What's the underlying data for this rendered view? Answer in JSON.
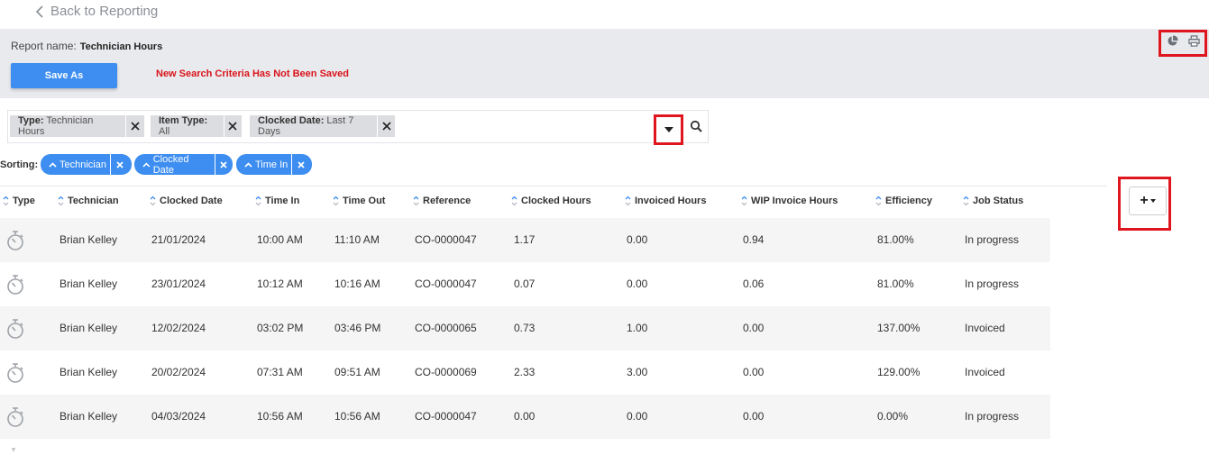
{
  "nav": {
    "back_label": "Back to Reporting"
  },
  "report": {
    "name_label": "Report name:",
    "name_value": "Technician Hours"
  },
  "actions": {
    "save_as_label": "Save As",
    "warning": "New Search Criteria Has Not Been Saved"
  },
  "filters": [
    {
      "key": "Type:",
      "value": "Technician Hours"
    },
    {
      "key": "Item Type:",
      "value": "All"
    },
    {
      "key": "Clocked Date:",
      "value": "Last 7 Days"
    }
  ],
  "sorting": {
    "label": "Sorting:",
    "items": [
      "Technician",
      "Clocked Date",
      "Time In"
    ]
  },
  "table": {
    "columns": [
      "Type",
      "Technician",
      "Clocked Date",
      "Time In",
      "Time Out",
      "Reference",
      "Clocked Hours",
      "Invoiced Hours",
      "WIP Invoice Hours",
      "Efficiency",
      "Job Status"
    ],
    "rows": [
      [
        "Brian Kelley",
        "21/01/2024",
        "10:00 AM",
        "11:10 AM",
        "CO-0000047",
        "1.17",
        "0.00",
        "0.94",
        "81.00%",
        "In progress"
      ],
      [
        "Brian Kelley",
        "23/01/2024",
        "10:12 AM",
        "10:16 AM",
        "CO-0000047",
        "0.07",
        "0.00",
        "0.06",
        "81.00%",
        "In progress"
      ],
      [
        "Brian Kelley",
        "12/02/2024",
        "03:02 PM",
        "03:46 PM",
        "CO-0000065",
        "0.73",
        "1.00",
        "0.00",
        "137.00%",
        "Invoiced"
      ],
      [
        "Brian Kelley",
        "20/02/2024",
        "07:31 AM",
        "09:51 AM",
        "CO-0000069",
        "2.33",
        "3.00",
        "0.00",
        "129.00%",
        "Invoiced"
      ],
      [
        "Brian Kelley",
        "04/03/2024",
        "10:56 AM",
        "10:56 AM",
        "CO-0000047",
        "0.00",
        "0.00",
        "0.00",
        "0.00%",
        "In progress"
      ]
    ]
  },
  "columns_button": {
    "label": "+"
  },
  "colors": {
    "accent": "#3d8ef0",
    "warning": "#d9141c",
    "band": "#e9eaed",
    "highlight": "#e0161e"
  }
}
